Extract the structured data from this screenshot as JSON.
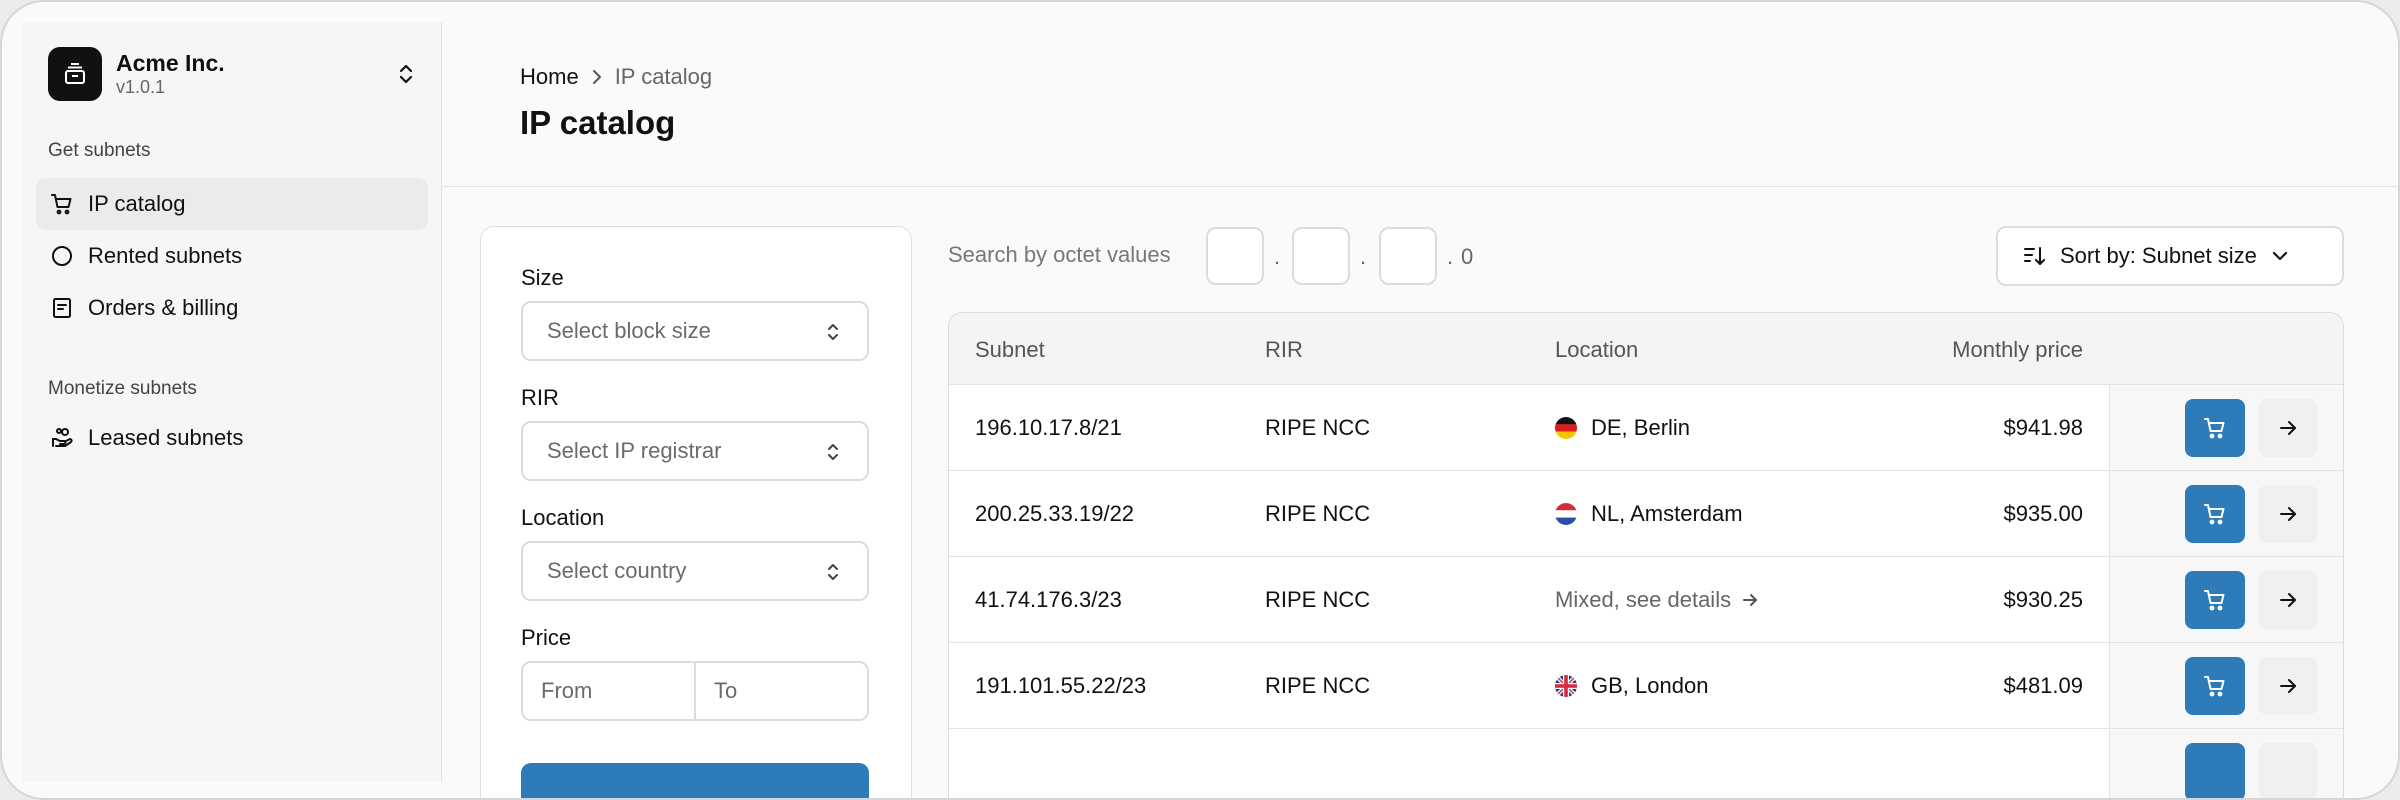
{
  "sidebar": {
    "team_name": "Acme Inc.",
    "team_version": "v1.0.1",
    "groups": [
      {
        "label": "Get subnets",
        "items": [
          {
            "label": "IP catalog",
            "icon": "cart-icon",
            "active": true
          },
          {
            "label": "Rented subnets",
            "icon": "circle-icon",
            "active": false
          },
          {
            "label": "Orders & billing",
            "icon": "receipt-icon",
            "active": false
          }
        ]
      },
      {
        "label": "Monetize subnets",
        "items": [
          {
            "label": "Leased subnets",
            "icon": "hand-coins-icon",
            "active": false
          }
        ]
      }
    ]
  },
  "header": {
    "breadcrumb": {
      "home": "Home",
      "current": "IP catalog"
    },
    "title": "IP catalog"
  },
  "filters": {
    "size": {
      "label": "Size",
      "placeholder": "Select block size"
    },
    "rir": {
      "label": "RIR",
      "placeholder": "Select IP registrar"
    },
    "location": {
      "label": "Location",
      "placeholder": "Select country"
    },
    "price": {
      "label": "Price",
      "from_placeholder": "From",
      "to_placeholder": "To"
    }
  },
  "search": {
    "label": "Search by octet values",
    "octets": [
      "",
      "",
      ""
    ],
    "last_octet": "0"
  },
  "sort": {
    "label": "Sort by: Subnet size"
  },
  "table": {
    "columns": [
      "Subnet",
      "RIR",
      "Location",
      "Monthly price"
    ],
    "rows": [
      {
        "subnet": "196.10.17.8/21",
        "rir": "RIPE NCC",
        "location": "DE, Berlin",
        "flag": "de",
        "mixed": false,
        "price": "$941.98"
      },
      {
        "subnet": "200.25.33.19/22",
        "rir": "RIPE NCC",
        "location": "NL, Amsterdam",
        "flag": "nl",
        "mixed": false,
        "price": "$935.00"
      },
      {
        "subnet": "41.74.176.3/23",
        "rir": "RIPE NCC",
        "location": "Mixed, see details",
        "flag": "",
        "mixed": true,
        "price": "$930.25"
      },
      {
        "subnet": "191.101.55.22/23",
        "rir": "RIPE NCC",
        "location": "GB, London",
        "flag": "gb",
        "mixed": false,
        "price": "$481.09"
      }
    ]
  },
  "colors": {
    "accent": "#2d7bb8",
    "text": "#111111",
    "muted": "#666666"
  }
}
